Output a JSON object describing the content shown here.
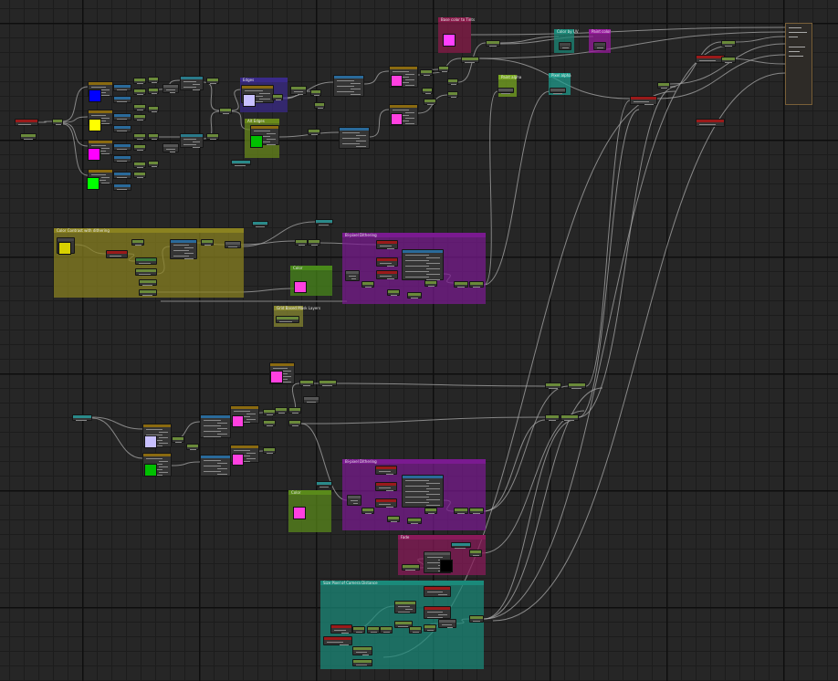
{
  "editor": {
    "type": "node-graph",
    "groups": [
      {
        "key": "blend_colors",
        "title": "Base color to Tints",
        "color": "#8a1a4a"
      },
      {
        "key": "edges",
        "title": "Edges",
        "color": "#3a2a8a"
      },
      {
        "key": "alt_edges",
        "title": "Alt Edges",
        "color": "#6a8a1a"
      },
      {
        "key": "color_by_uv",
        "title": "Color by UV",
        "color": "#1a8a7a"
      },
      {
        "key": "paint_color",
        "title": "Paint color",
        "color": "#9a1aa0"
      },
      {
        "key": "paint_alpha",
        "title": "Paint alpha",
        "color": "#7aaa20"
      },
      {
        "key": "sample_levels",
        "title": "Color Contrast with dithering",
        "color": "#8a8220"
      },
      {
        "key": "bi_pixel_1",
        "title": "Bi-pixel Dithering",
        "color": "#7a1a90"
      },
      {
        "key": "color_1",
        "title": "Color",
        "color": "#4a8a1a"
      },
      {
        "key": "grid_note",
        "title": "Grid Based Mask Layers",
        "color": "#8a8a30"
      },
      {
        "key": "bi_pixel_2",
        "title": "Bi-pixel Dithering",
        "color": "#7a1a90"
      },
      {
        "key": "color_2",
        "title": "Color",
        "color": "#5a8a1a"
      },
      {
        "key": "fade",
        "title": "Fade",
        "color": "#8a1a5a"
      },
      {
        "key": "screen_depth",
        "title": "Size Pixel of Camera Distance",
        "color": "#1a8a7a"
      },
      {
        "key": "pixel_alpha",
        "title": "Pixel alpha",
        "color": "#20a090"
      },
      {
        "key": "pixel_color",
        "title": "Pixel color",
        "color": "#20a090"
      }
    ],
    "swatches": [
      {
        "key": "blue",
        "color": "#0000ff"
      },
      {
        "key": "yellow",
        "color": "#ffff00"
      },
      {
        "key": "magenta_a",
        "color": "#ff00ff"
      },
      {
        "key": "green_a",
        "color": "#00ff00"
      },
      {
        "key": "lavender_edges",
        "color": "#c8c0ff"
      },
      {
        "key": "green_alt",
        "color": "#00c000"
      },
      {
        "key": "magenta_tint",
        "color": "#ff40ff"
      },
      {
        "key": "pink_mid_1",
        "color": "#ff40e0"
      },
      {
        "key": "pink_mid_2",
        "color": "#ff40e0"
      },
      {
        "key": "pink_color1",
        "color": "#ff40e0"
      },
      {
        "key": "pink_left_1",
        "color": "#ff40e0"
      },
      {
        "key": "lavender_low",
        "color": "#c8c0ff"
      },
      {
        "key": "green_low",
        "color": "#00c000"
      },
      {
        "key": "pink_low_1",
        "color": "#ff40e0"
      },
      {
        "key": "pink_low_2",
        "color": "#ff40e0"
      },
      {
        "key": "pink_color2",
        "color": "#ff40e0"
      },
      {
        "key": "yellow_levels",
        "color": "#d8d000"
      },
      {
        "key": "black_fade",
        "color": "#000000"
      }
    ]
  }
}
